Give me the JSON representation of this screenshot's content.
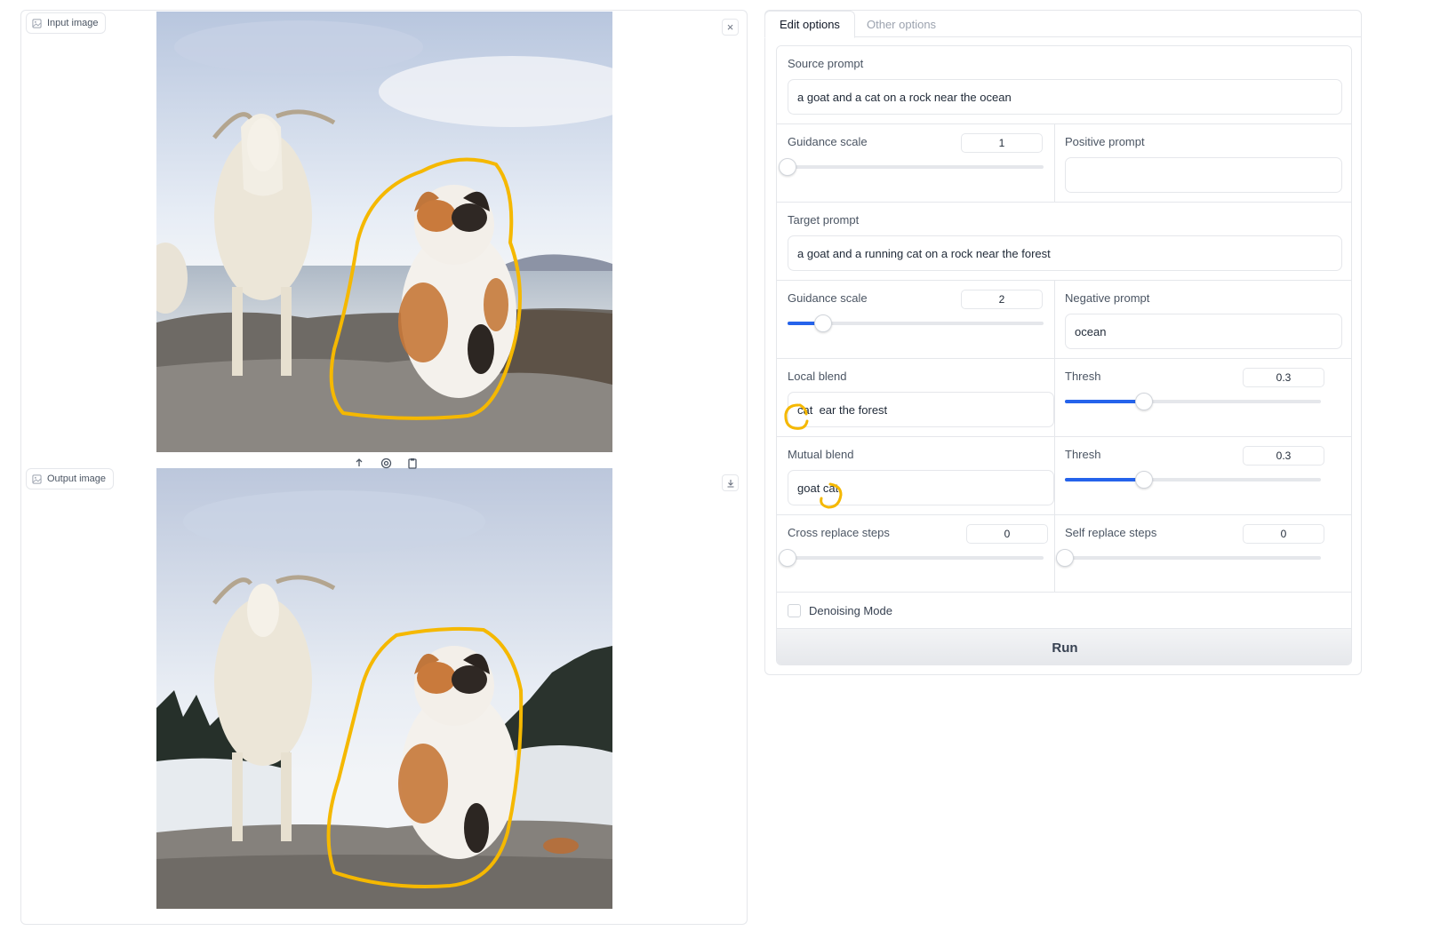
{
  "input_panel": {
    "label": "Input image",
    "close_icon": "close-icon",
    "tools": [
      "upload-icon",
      "webcam-icon",
      "clipboard-icon"
    ]
  },
  "output_panel": {
    "label": "Output image",
    "download_icon": "download-icon"
  },
  "tabs": [
    {
      "label": "Edit options",
      "active": true
    },
    {
      "label": "Other options",
      "active": false
    }
  ],
  "form": {
    "source_prompt": {
      "label": "Source prompt",
      "value": "a goat and a cat on a rock near the ocean"
    },
    "source_guidance": {
      "label": "Guidance scale",
      "value": "1",
      "fraction": 0.0
    },
    "positive_prompt": {
      "label": "Positive prompt",
      "value": ""
    },
    "target_prompt": {
      "label": "Target prompt",
      "value": "a goat and a running cat on a rock near the forest"
    },
    "target_guidance": {
      "label": "Guidance scale",
      "value": "2",
      "fraction": 0.14
    },
    "negative_prompt": {
      "label": "Negative prompt",
      "value": "ocean"
    },
    "local_blend": {
      "label": "Local blend",
      "value": "cat  ear the forest"
    },
    "local_thresh": {
      "label": "Thresh",
      "value": "0.3",
      "fraction": 0.31
    },
    "mutual_blend": {
      "label": "Mutual blend",
      "value": "goat cat"
    },
    "mutual_thresh": {
      "label": "Thresh",
      "value": "0.3",
      "fraction": 0.31
    },
    "cross_replace": {
      "label": "Cross replace steps",
      "value": "0",
      "fraction": 0.0
    },
    "self_replace": {
      "label": "Self replace steps",
      "value": "0",
      "fraction": 0.0
    },
    "denoising": {
      "label": "Denoising Mode",
      "checked": false
    },
    "run_label": "Run"
  },
  "colors": {
    "accent": "#2563eb",
    "annotation": "#f5b800",
    "border": "#e5e7eb"
  }
}
